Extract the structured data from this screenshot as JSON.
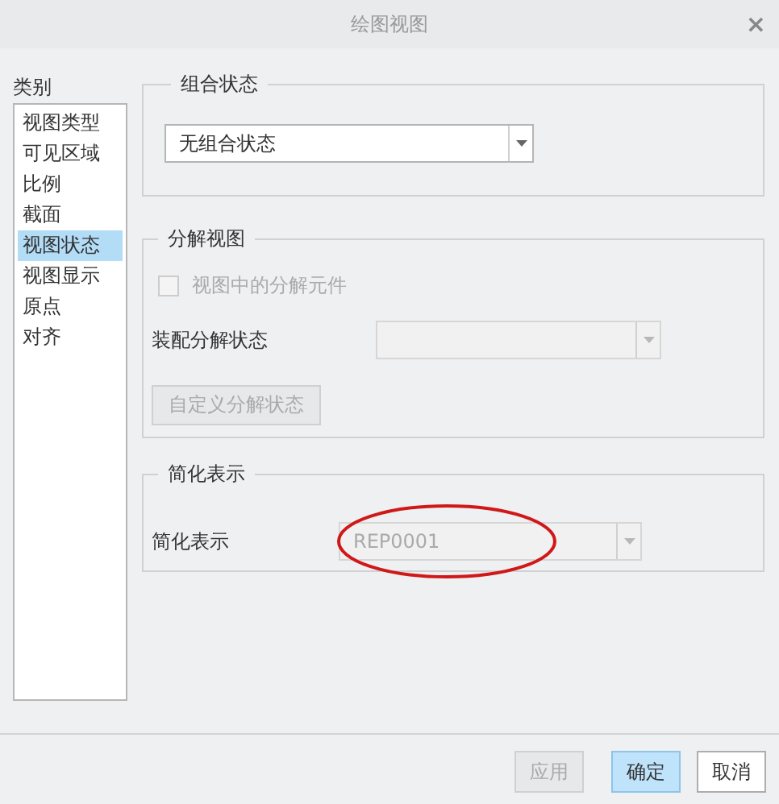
{
  "window": {
    "title": "绘图视图",
    "close": "×"
  },
  "categories": {
    "label": "类别",
    "items": [
      {
        "label": "视图类型",
        "selected": false
      },
      {
        "label": "可见区域",
        "selected": false
      },
      {
        "label": "比例",
        "selected": false
      },
      {
        "label": "截面",
        "selected": false
      },
      {
        "label": "视图状态",
        "selected": true
      },
      {
        "label": "视图显示",
        "selected": false
      },
      {
        "label": "原点",
        "selected": false
      },
      {
        "label": "对齐",
        "selected": false
      }
    ]
  },
  "combination_state": {
    "title": "组合状态",
    "dropdown": {
      "value": "无组合状态",
      "disabled": false
    }
  },
  "exploded_view": {
    "title": "分解视图",
    "checkbox": {
      "label": "视图中的分解元件",
      "checked": false,
      "disabled": true
    },
    "assembly_explode_state": {
      "label": "装配分解状态",
      "dropdown": {
        "disabled": true
      }
    },
    "custom_button": {
      "label": "自定义分解状态",
      "disabled": true
    }
  },
  "simplified_rep": {
    "title": "简化表示",
    "label": "简化表示",
    "dropdown": {
      "value": "REP0001",
      "disabled": true
    },
    "highlighted": true
  },
  "buttons": [
    {
      "label": "应用",
      "disabled": true,
      "default": false
    },
    {
      "label": "确定",
      "disabled": false,
      "default": true
    },
    {
      "label": "取消",
      "disabled": false,
      "default": false
    }
  ]
}
